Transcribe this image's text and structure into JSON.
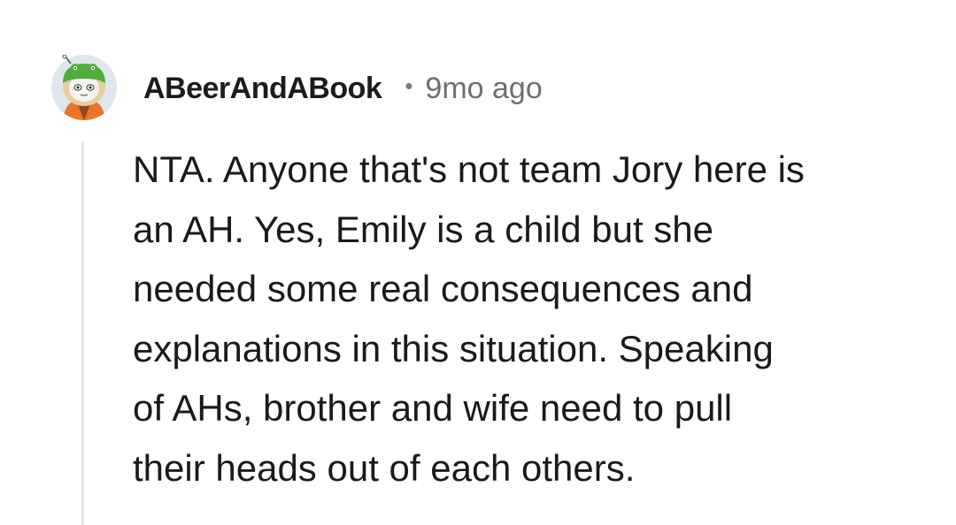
{
  "comment": {
    "author": "ABeerAndABook",
    "separator": "•",
    "age": "9mo ago",
    "body_lines": [
      "NTA. Anyone that's not team Jory here is",
      "an AH. Yes, Emily is a child but she",
      "needed some real consequences and",
      "explanations in this situation. Speaking",
      "of AHs, brother and wife need to pull",
      "their heads out of each others."
    ],
    "avatar_icon": "snoo-avatar-icon"
  },
  "colors": {
    "background": "#ffffff",
    "text": "#1a1a1b",
    "meta": "#6f6f6f",
    "thread_line": "#e4e4e4"
  }
}
